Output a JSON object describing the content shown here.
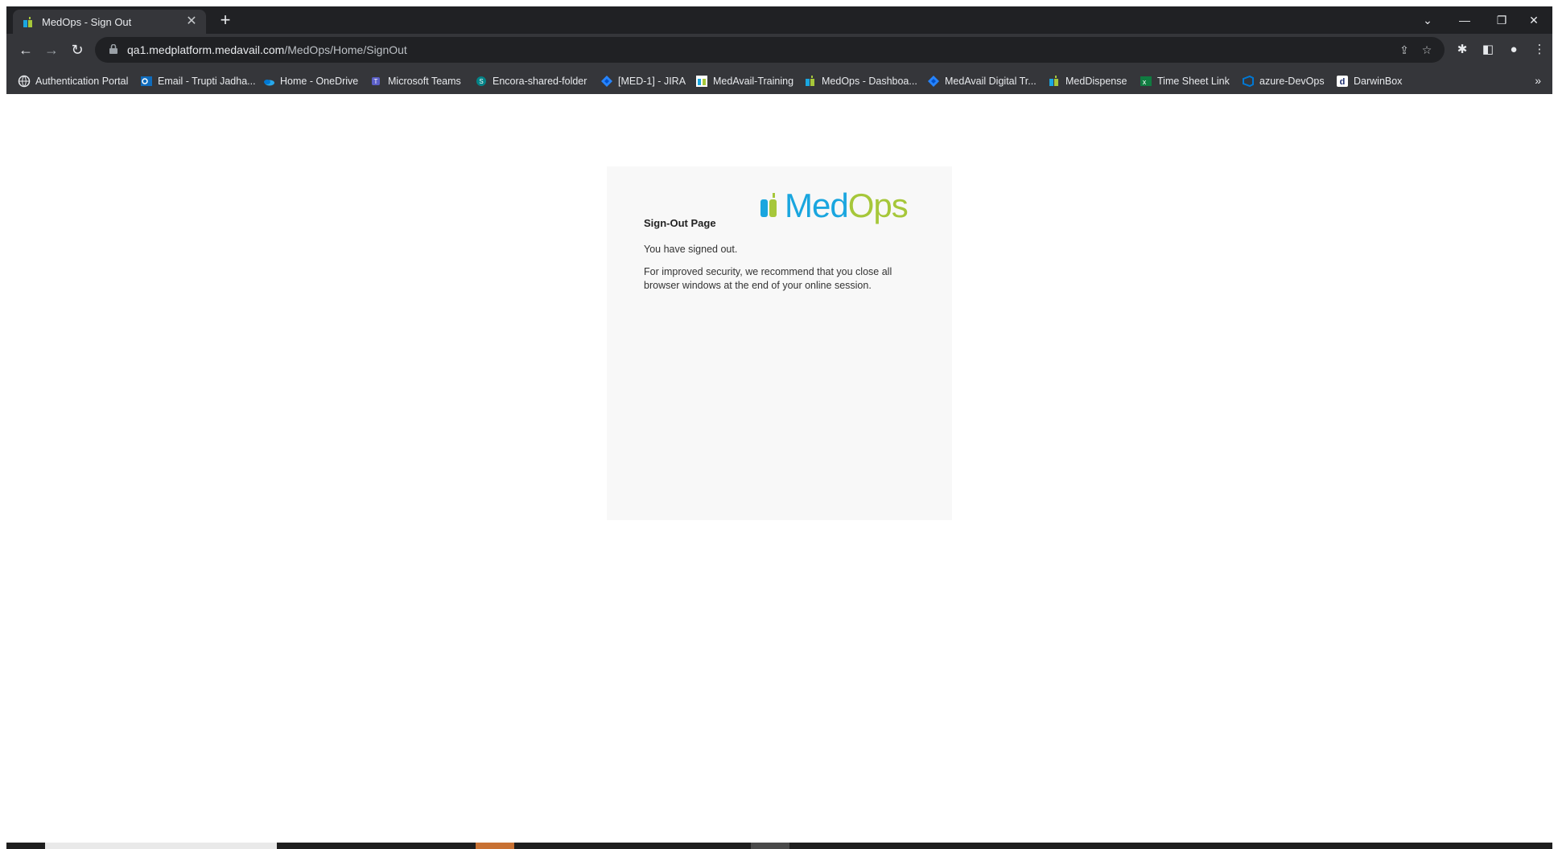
{
  "tab": {
    "title": "MedOps - Sign Out"
  },
  "address_bar": {
    "host": "qa1.medplatform.medavail.com",
    "path": "/MedOps/Home/SignOut"
  },
  "bookmarks": [
    {
      "label": "Authentication Portal",
      "icon": "globe-icon"
    },
    {
      "label": "Email - Trupti Jadha...",
      "icon": "outlook-icon"
    },
    {
      "label": "Home - OneDrive",
      "icon": "onedrive-icon"
    },
    {
      "label": "Microsoft Teams",
      "icon": "teams-icon"
    },
    {
      "label": "Encora-shared-folder",
      "icon": "sharepoint-icon"
    },
    {
      "label": "[MED-1] - JIRA",
      "icon": "jira-icon"
    },
    {
      "label": "MedAvail-Training",
      "icon": "medavail-icon"
    },
    {
      "label": "MedOps - Dashboa...",
      "icon": "medops-icon"
    },
    {
      "label": "MedAvail Digital Tr...",
      "icon": "jira-icon"
    },
    {
      "label": "MedDispense",
      "icon": "medops-icon"
    },
    {
      "label": "Time Sheet Link",
      "icon": "excel-icon"
    },
    {
      "label": "azure-DevOps",
      "icon": "azure-devops-icon"
    },
    {
      "label": "DarwinBox",
      "icon": "darwinbox-icon"
    }
  ],
  "page": {
    "logo_text": "MedOps",
    "title": "Sign-Out Page",
    "message": "You have signed out.",
    "security_note": "For improved security, we recommend that you close all browser windows at the end of your online session."
  },
  "colors": {
    "logo_blue": "#1aa6df",
    "logo_green": "#a6c73a",
    "chrome_dark": "#202124",
    "chrome_toolbar": "#35363a"
  }
}
